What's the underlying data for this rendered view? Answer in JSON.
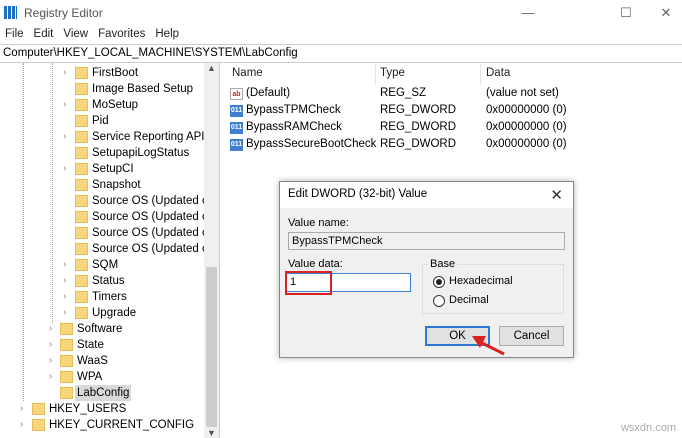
{
  "window": {
    "title": "Registry Editor",
    "minimize": "—",
    "maximize": "☐",
    "close": "✕"
  },
  "menu": [
    "File",
    "Edit",
    "View",
    "Favorites",
    "Help"
  ],
  "address": "Computer\\HKEY_LOCAL_MACHINE\\SYSTEM\\LabConfig",
  "tree": [
    {
      "label": "FirstBoot",
      "level": 2,
      "expandable": true
    },
    {
      "label": "Image Based Setup",
      "level": 2,
      "expandable": false
    },
    {
      "label": "MoSetup",
      "level": 2,
      "expandable": true
    },
    {
      "label": "Pid",
      "level": 2,
      "expandable": false
    },
    {
      "label": "Service Reporting API",
      "level": 2,
      "expandable": true
    },
    {
      "label": "SetupapiLogStatus",
      "level": 2,
      "expandable": false
    },
    {
      "label": "SetupCI",
      "level": 2,
      "expandable": true
    },
    {
      "label": "Snapshot",
      "level": 2,
      "expandable": false
    },
    {
      "label": "Source OS (Updated on",
      "level": 2,
      "expandable": false
    },
    {
      "label": "Source OS (Updated on",
      "level": 2,
      "expandable": false
    },
    {
      "label": "Source OS (Updated on",
      "level": 2,
      "expandable": false
    },
    {
      "label": "Source OS (Updated on",
      "level": 2,
      "expandable": false
    },
    {
      "label": "SQM",
      "level": 2,
      "expandable": true
    },
    {
      "label": "Status",
      "level": 2,
      "expandable": true
    },
    {
      "label": "Timers",
      "level": 2,
      "expandable": true
    },
    {
      "label": "Upgrade",
      "level": 2,
      "expandable": true
    },
    {
      "label": "Software",
      "level": 1,
      "expandable": true
    },
    {
      "label": "State",
      "level": 1,
      "expandable": true
    },
    {
      "label": "WaaS",
      "level": 1,
      "expandable": true
    },
    {
      "label": "WPA",
      "level": 1,
      "expandable": true
    },
    {
      "label": "LabConfig",
      "level": 1,
      "expandable": false,
      "selected": true
    },
    {
      "label": "HKEY_USERS",
      "level": 0,
      "expandable": true
    },
    {
      "label": "HKEY_CURRENT_CONFIG",
      "level": 0,
      "expandable": true
    }
  ],
  "list": {
    "headers": {
      "name": "Name",
      "type": "Type",
      "data": "Data"
    },
    "rows": [
      {
        "icon": "string-value-icon",
        "icon_text": "ab",
        "name": "(Default)",
        "type": "REG_SZ",
        "data": "(value not set)"
      },
      {
        "icon": "binary-value-icon",
        "icon_text": "011",
        "name": "BypassTPMCheck",
        "type": "REG_DWORD",
        "data": "0x00000000 (0)"
      },
      {
        "icon": "binary-value-icon",
        "icon_text": "011",
        "name": "BypassRAMCheck",
        "type": "REG_DWORD",
        "data": "0x00000000 (0)"
      },
      {
        "icon": "binary-value-icon",
        "icon_text": "011",
        "name": "BypassSecureBootCheck",
        "type": "REG_DWORD",
        "data": "0x00000000 (0)"
      }
    ]
  },
  "dialog": {
    "title": "Edit DWORD (32-bit) Value",
    "close": "✕",
    "value_name_label": "Value name:",
    "value_name": "BypassTPMCheck",
    "value_data_label": "Value data:",
    "value_data": "1",
    "base_label": "Base",
    "hex_label": "Hexadecimal",
    "dec_label": "Decimal",
    "base_selected": "Hexadecimal",
    "ok": "OK",
    "cancel": "Cancel"
  },
  "watermark": "wsxdn.com",
  "colors": {
    "highlight": "#d22222",
    "accent": "#2b79d0"
  }
}
